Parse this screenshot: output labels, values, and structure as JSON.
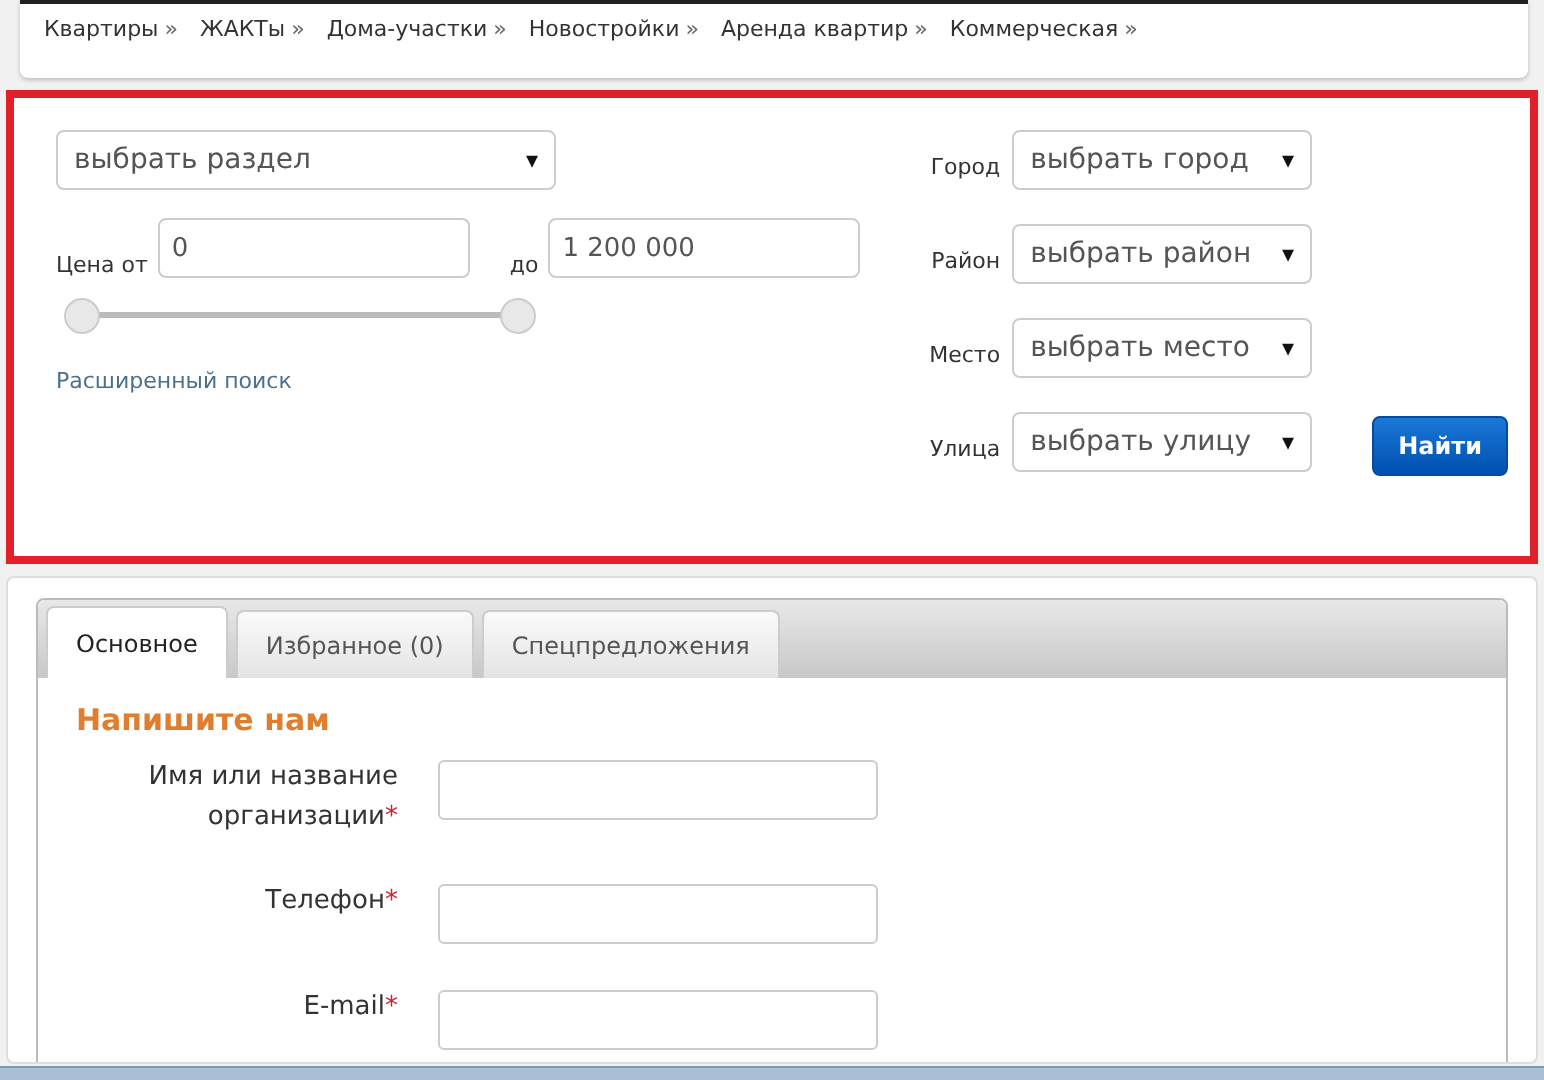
{
  "nav": [
    {
      "label": "Квартиры",
      "arrow": "»"
    },
    {
      "label": "ЖАКТы",
      "arrow": "»"
    },
    {
      "label": "Дома-участки",
      "arrow": "»"
    },
    {
      "label": "Новостройки",
      "arrow": "»"
    },
    {
      "label": "Аренда квартир",
      "arrow": "»"
    },
    {
      "label": "Коммерческая",
      "arrow": "»"
    }
  ],
  "search": {
    "section": {
      "value": "выбрать раздел",
      "caret": "▾"
    },
    "price_from": {
      "label": "Цена от",
      "value": "0"
    },
    "price_to": {
      "label": "до",
      "value": "1 200 000"
    },
    "price_slider": {
      "level": 1
    },
    "advanced_link": "Расширенный поиск",
    "filters": [
      {
        "label": "Город",
        "value": "выбрать город",
        "caret": "▾"
      },
      {
        "label": "Район",
        "value": "выбрать район",
        "caret": "▾"
      },
      {
        "label": "Место",
        "value": "выбрать место",
        "caret": "▾"
      },
      {
        "label": "Улица",
        "value": "выбрать улицу",
        "caret": "▾"
      }
    ],
    "submit": "Найти"
  },
  "tabs": [
    {
      "label": "Основное",
      "selected": true
    },
    {
      "label": "Избранное (0)",
      "selected": false
    },
    {
      "label": "Спецпредложения",
      "selected": false
    }
  ],
  "form": {
    "title": "Напишите нам",
    "fields": [
      {
        "label": "Имя или название организации",
        "required_mark": "*"
      },
      {
        "label": "Телефон",
        "required_mark": "*"
      },
      {
        "label": "E-mail",
        "required_mark": "*"
      }
    ]
  }
}
